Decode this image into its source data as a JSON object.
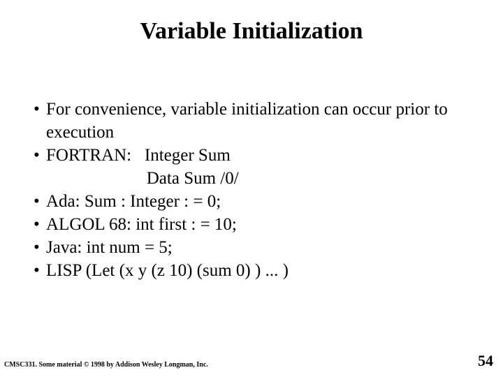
{
  "title": "Variable Initialization",
  "bullets": {
    "b1": "For convenience, variable initialization can occur prior to execution",
    "b2a": "FORTRAN:   Integer Sum",
    "b2b": "                       Data Sum /0/",
    "b3": "Ada:  Sum : Integer : = 0;",
    "b4": "ALGOL 68:  int first : = 10;",
    "b5": "Java:  int num = 5;",
    "b6": "LISP  (Let (x y (z 10) (sum 0) ) ... )"
  },
  "footer_left": "CMSC331.  Some material © 1998 by Addison Wesley Longman, Inc.",
  "page_number": "54"
}
